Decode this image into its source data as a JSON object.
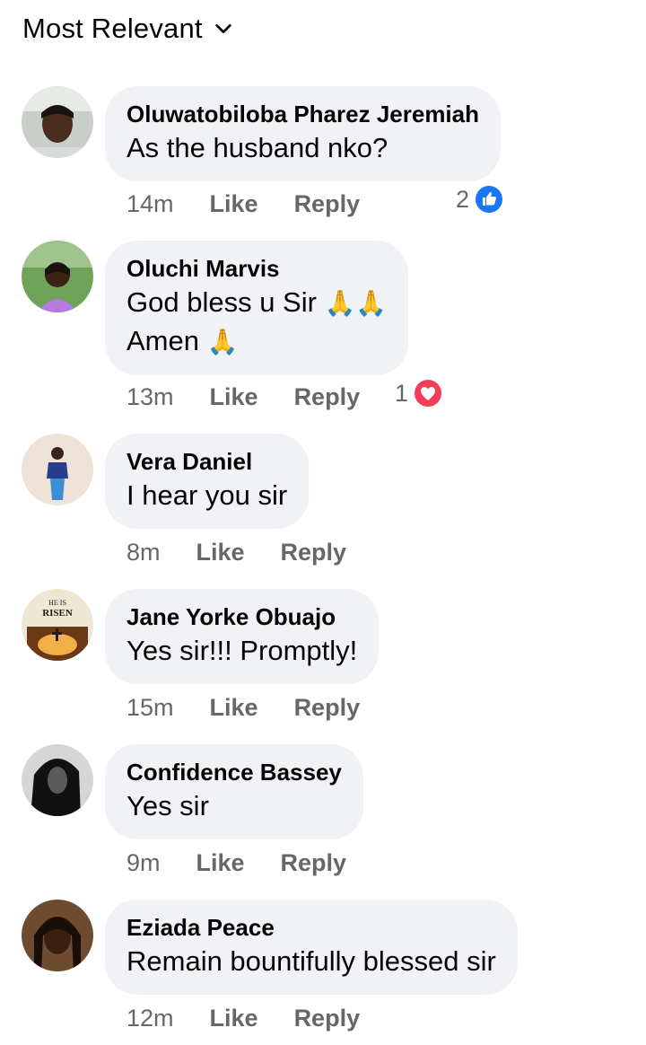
{
  "sort": {
    "label": "Most Relevant"
  },
  "colors": {
    "bubble": "#f0f2f5",
    "meta": "#65676b",
    "like_blue": "#1877f2",
    "love_red": "#f33e58"
  },
  "comments": [
    {
      "author": "Oluwatobiloba Pharez Jeremiah",
      "lines": [
        "As the husband nko?"
      ],
      "time": "14m",
      "like": "Like",
      "reply": "Reply",
      "reaction_count": "2",
      "reaction": "like-reaction-icon"
    },
    {
      "author": "Oluchi Marvis",
      "lines": [
        "God bless u Sir",
        "Amen"
      ],
      "emoji": [
        "🙏🙏",
        "🙏"
      ],
      "time": "13m",
      "like": "Like",
      "reply": "Reply",
      "reaction_count": "1",
      "reaction": "love-reaction-icon"
    },
    {
      "author": "Vera Daniel",
      "lines": [
        "I hear you sir"
      ],
      "time": "8m",
      "like": "Like",
      "reply": "Reply"
    },
    {
      "author": "Jane Yorke Obuajo",
      "lines": [
        "Yes sir!!! Promptly!"
      ],
      "time": "15m",
      "like": "Like",
      "reply": "Reply",
      "avatar_text": [
        "HE IS",
        "RISEN"
      ]
    },
    {
      "author": "Confidence Bassey",
      "lines": [
        "Yes sir"
      ],
      "time": "9m",
      "like": "Like",
      "reply": "Reply"
    },
    {
      "author": "Eziada Peace",
      "lines": [
        "Remain bountifully blessed sir"
      ],
      "time": "12m",
      "like": "Like",
      "reply": "Reply"
    }
  ]
}
